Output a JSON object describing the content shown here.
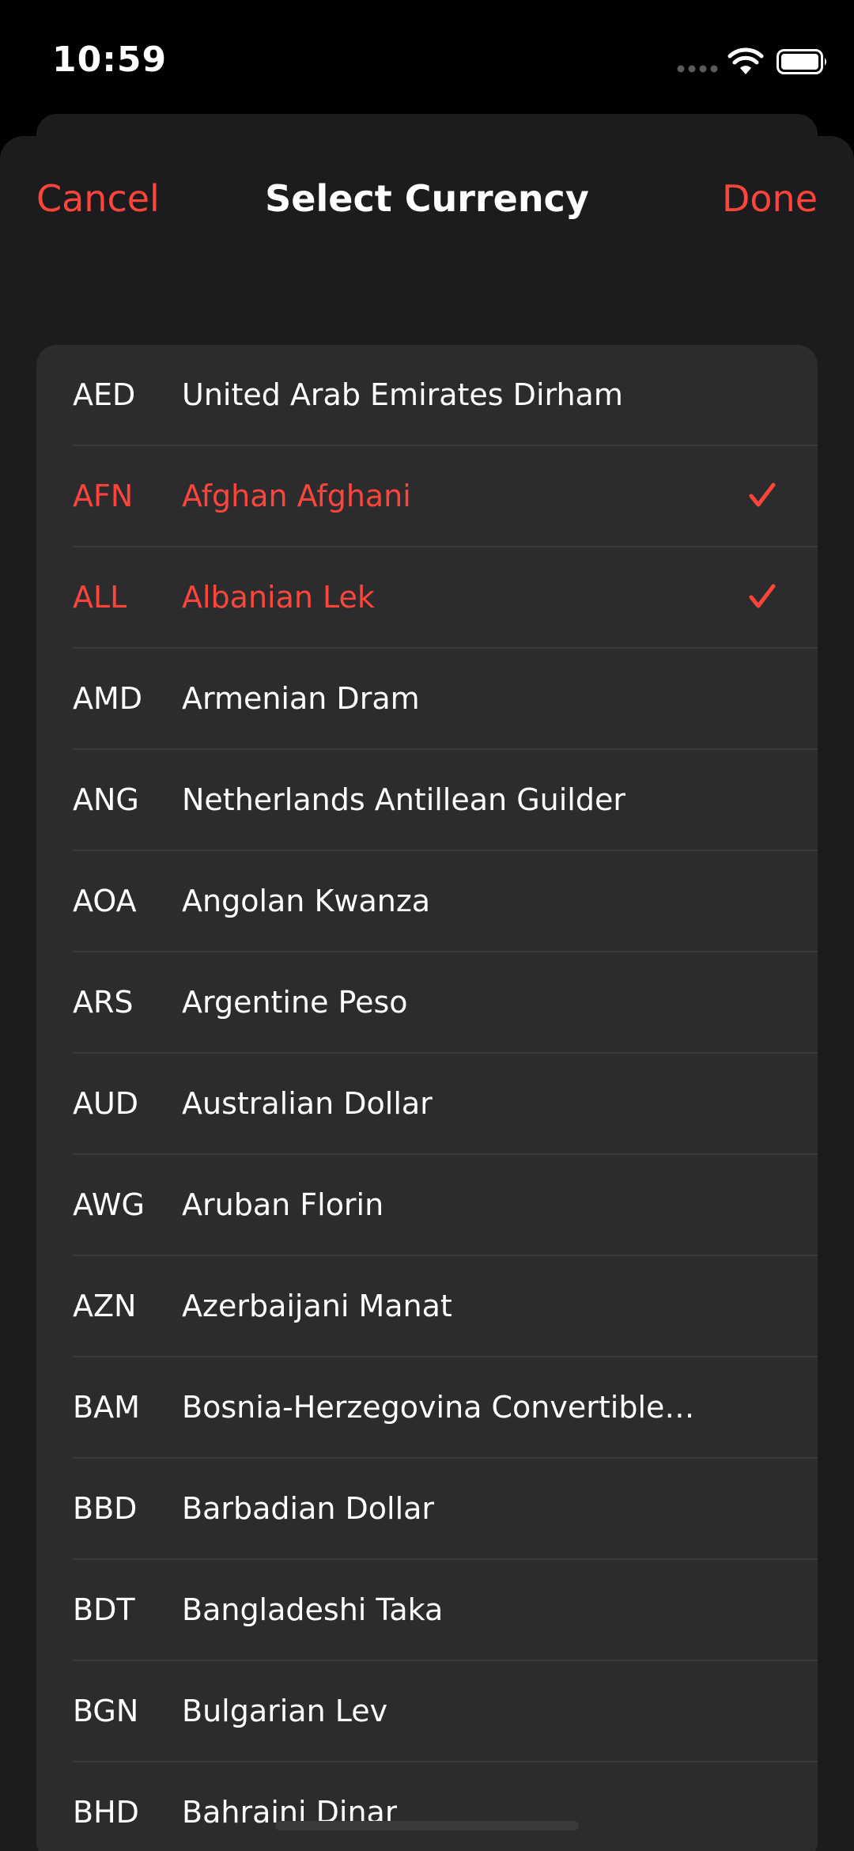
{
  "status_bar": {
    "time": "10:59",
    "icons": [
      "signal-dots-icon",
      "wifi-icon",
      "battery-icon"
    ]
  },
  "nav": {
    "cancel_label": "Cancel",
    "title": "Select Currency",
    "done_label": "Done"
  },
  "colors": {
    "accent": "#ff453a",
    "sheet_background": "#1c1c1e",
    "list_background": "#2c2c2e",
    "separator": "#3a3a3c"
  },
  "currencies": [
    {
      "code": "AED",
      "name": "United Arab Emirates Dirham",
      "selected": false
    },
    {
      "code": "AFN",
      "name": "Afghan Afghani",
      "selected": true
    },
    {
      "code": "ALL",
      "name": "Albanian Lek",
      "selected": true
    },
    {
      "code": "AMD",
      "name": "Armenian Dram",
      "selected": false
    },
    {
      "code": "ANG",
      "name": "Netherlands Antillean Guilder",
      "selected": false
    },
    {
      "code": "AOA",
      "name": "Angolan Kwanza",
      "selected": false
    },
    {
      "code": "ARS",
      "name": "Argentine Peso",
      "selected": false
    },
    {
      "code": "AUD",
      "name": "Australian Dollar",
      "selected": false
    },
    {
      "code": "AWG",
      "name": "Aruban Florin",
      "selected": false
    },
    {
      "code": "AZN",
      "name": "Azerbaijani Manat",
      "selected": false
    },
    {
      "code": "BAM",
      "name": "Bosnia-Herzegovina Convertible…",
      "selected": false
    },
    {
      "code": "BBD",
      "name": "Barbadian Dollar",
      "selected": false
    },
    {
      "code": "BDT",
      "name": "Bangladeshi Taka",
      "selected": false
    },
    {
      "code": "BGN",
      "name": "Bulgarian Lev",
      "selected": false
    },
    {
      "code": "BHD",
      "name": "Bahraini Dinar",
      "selected": false
    }
  ]
}
